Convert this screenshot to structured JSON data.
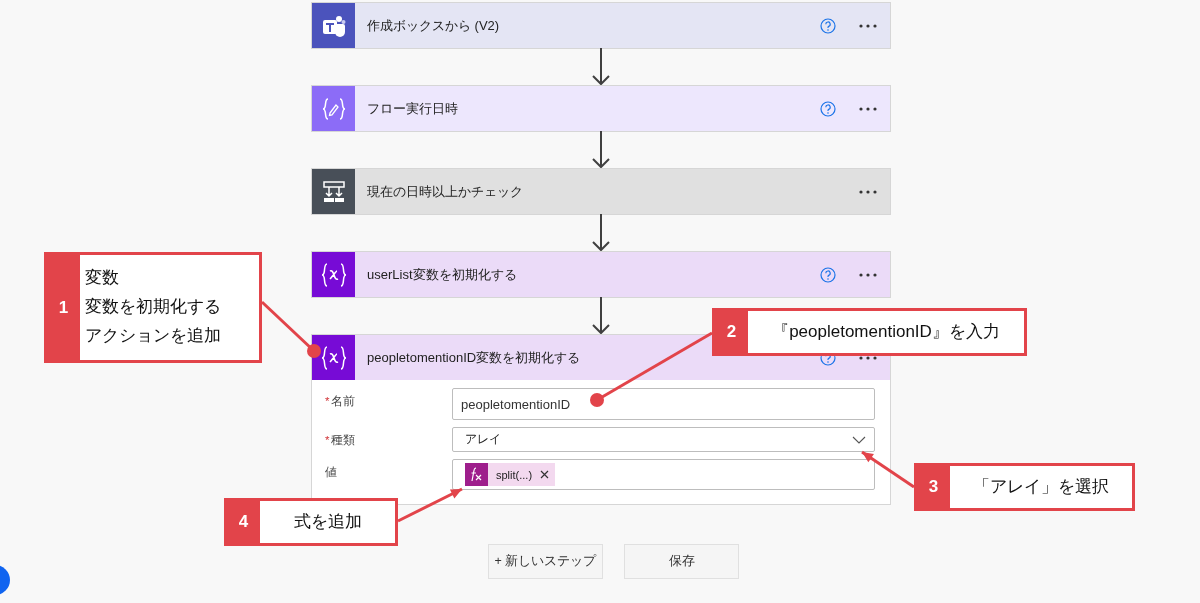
{
  "steps": [
    {
      "kind": "teams",
      "title": "作成ボックスから (V2)",
      "help": true,
      "expanded": false
    },
    {
      "kind": "compose",
      "title": "フロー実行日時",
      "help": true,
      "expanded": false
    },
    {
      "kind": "condition",
      "title": "現在の日時以上かチェック",
      "help": false,
      "expanded": false
    },
    {
      "kind": "variable",
      "title": "userList変数を初期化する",
      "help": true,
      "expanded": false
    },
    {
      "kind": "variable",
      "title": "peopletomentionID変数を初期化する",
      "help": true,
      "expanded": true,
      "fields": [
        {
          "kind": "text",
          "marker": "*",
          "label": "名前",
          "value": "peopletomentionID"
        },
        {
          "kind": "dropdown",
          "marker": "*",
          "label": "種類",
          "value": "アレイ"
        },
        {
          "kind": "tokens",
          "label": "値",
          "tokens": [
            {
              "label": "split(...)"
            }
          ]
        }
      ]
    }
  ],
  "buttons": [
    "+ 新しいステップ",
    "保存"
  ],
  "callouts": [
    {
      "kind": "dot",
      "number": "1",
      "lines": [
        "変数",
        "変数を初期化する",
        "アクションを追加"
      ]
    },
    {
      "kind": "dot",
      "number": "2",
      "lines": [
        "『peopletomentionID』を入力"
      ]
    },
    {
      "kind": "arrow",
      "number": "3",
      "lines": [
        "「アレイ」を選択"
      ]
    },
    {
      "kind": "arrow",
      "number": "4",
      "lines": [
        "式を追加"
      ]
    }
  ]
}
